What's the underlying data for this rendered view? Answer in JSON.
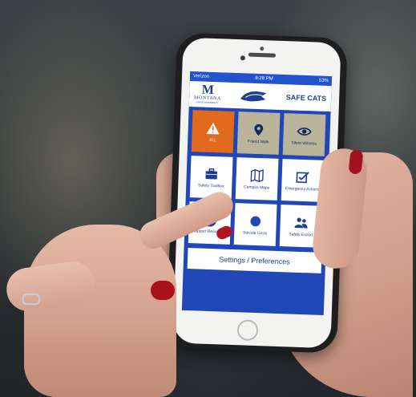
{
  "app": {
    "status": {
      "carrier": "Verizon",
      "time": "8:28 PM",
      "battery": "53%"
    },
    "header": {
      "logo_letter": "M",
      "logo_word": "MONTANA",
      "logo_sub": "STATE UNIVERSITY",
      "title": "SAFE CATS"
    },
    "tiles": [
      {
        "label": "911",
        "icon": "warning-icon"
      },
      {
        "label": "Friend Walk",
        "icon": "map-pin-icon"
      },
      {
        "label": "Silent Witness",
        "icon": "eye-icon"
      },
      {
        "label": "Safety Toolbox",
        "icon": "toolbox-icon"
      },
      {
        "label": "Campus Maps",
        "icon": "map-icon"
      },
      {
        "label": "Emergency Actions",
        "icon": "checkbox-icon"
      },
      {
        "label": "Support Resources",
        "icon": "lifebuoy-icon"
      },
      {
        "label": "Suicide Crisis",
        "icon": "circle-icon"
      },
      {
        "label": "Safety Escort",
        "icon": "people-icon"
      }
    ],
    "preferences_label": "Settings / Preferences"
  },
  "colors": {
    "brand_blue": "#1f47b8",
    "orange": "#e26a1e",
    "gold": "#b9b49a"
  }
}
